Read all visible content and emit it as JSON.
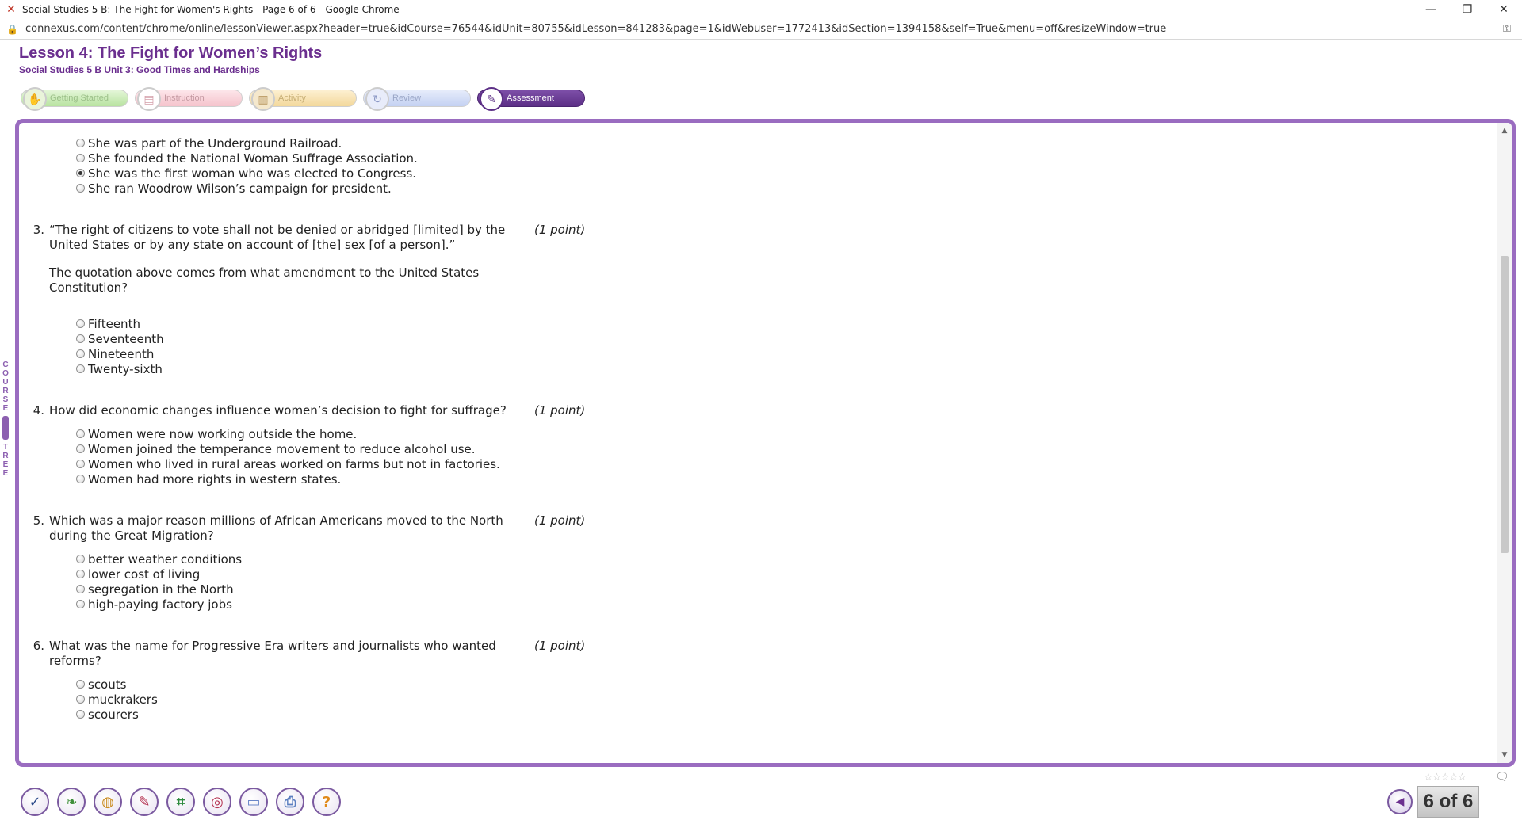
{
  "browser": {
    "window_title": "Social Studies 5 B: The Fight for Women's Rights - Page 6 of 6 - Google Chrome",
    "url": "connexus.com/content/chrome/online/lessonViewer.aspx?header=true&idCourse=76544&idUnit=80755&idLesson=841283&page=1&idWebuser=1772413&idSection=1394158&self=True&menu=off&resizeWindow=true",
    "minimize_icon": "minimize-icon",
    "maximize_icon": "restore-icon",
    "close_icon": "close-icon"
  },
  "lesson": {
    "title": "Lesson 4: The Fight for Women’s Rights",
    "subtitle": "Social Studies 5 B  Unit 3: Good Times and Hardships"
  },
  "tabs": [
    {
      "label": "Getting Started",
      "icon": "getting-started-icon"
    },
    {
      "label": "Instruction",
      "icon": "instruction-icon"
    },
    {
      "label": "Activity",
      "icon": "activity-icon"
    },
    {
      "label": "Review",
      "icon": "review-icon"
    },
    {
      "label": "Assessment",
      "icon": "assessment-icon",
      "active": true
    }
  ],
  "course_tree": {
    "letters": [
      "C",
      "O",
      "U",
      "R",
      "S",
      "E",
      "T",
      "R",
      "E",
      "E"
    ]
  },
  "questions": [
    {
      "number": "",
      "text": "",
      "points": "",
      "options": [
        {
          "label": "She was part of the Underground Railroad.",
          "selected": false
        },
        {
          "label": "She founded the National Woman Suffrage Association.",
          "selected": false
        },
        {
          "label": "She was the first woman who was elected to Congress.",
          "selected": true
        },
        {
          "label": "She ran Woodrow Wilson’s campaign for president.",
          "selected": false
        }
      ]
    },
    {
      "number": "3.",
      "text": "“The right of citizens to vote shall not be denied or abridged [limited] by the United States or by any state on account of [the] sex [of a person].”",
      "extra": "The quotation above comes from what amendment to the United States Constitution?",
      "points": "(1 point)",
      "options": [
        {
          "label": "Fifteenth",
          "selected": false
        },
        {
          "label": "Seventeenth",
          "selected": false
        },
        {
          "label": "Nineteenth",
          "selected": false
        },
        {
          "label": "Twenty-sixth",
          "selected": false
        }
      ]
    },
    {
      "number": "4.",
      "text": "How did economic changes influence women’s decision to fight for suffrage?",
      "points": "(1 point)",
      "options": [
        {
          "label": "Women were now working outside the home.",
          "selected": false
        },
        {
          "label": "Women joined the temperance movement to reduce alcohol use.",
          "selected": false
        },
        {
          "label": "Women who lived in rural areas worked on farms but not in factories.",
          "selected": false
        },
        {
          "label": "Women had more rights in western states.",
          "selected": false
        }
      ]
    },
    {
      "number": "5.",
      "text": "Which was a major reason millions of African Americans moved to the North during the Great Migration?",
      "points": "(1 point)",
      "options": [
        {
          "label": "better weather conditions",
          "selected": false
        },
        {
          "label": "lower cost of living",
          "selected": false
        },
        {
          "label": "segregation in the North",
          "selected": false
        },
        {
          "label": "high-paying factory jobs",
          "selected": false
        }
      ]
    },
    {
      "number": "6.",
      "text": "What was the name for Progressive Era writers and journalists who wanted reforms?",
      "points": "(1 point)",
      "options": [
        {
          "label": "scouts",
          "selected": false
        },
        {
          "label": "muckrakers",
          "selected": false
        },
        {
          "label": "scourers",
          "selected": false
        }
      ]
    }
  ],
  "toolbar": {
    "tools": [
      {
        "icon": "checkmark-icon",
        "glyph": "✓",
        "color": "#2b4a8a"
      },
      {
        "icon": "book-icon",
        "glyph": "❧",
        "color": "#3f8f3a"
      },
      {
        "icon": "globe-icon",
        "glyph": "◍",
        "color": "#c98a1d"
      },
      {
        "icon": "pushpin-icon",
        "glyph": "✎",
        "color": "#b3304f"
      },
      {
        "icon": "calculator-icon",
        "glyph": "⌗",
        "color": "#2e8a3e"
      },
      {
        "icon": "target-icon",
        "glyph": "◎",
        "color": "#b3304f"
      },
      {
        "icon": "screen-icon",
        "glyph": "▭",
        "color": "#6a86c8"
      },
      {
        "icon": "print-icon",
        "glyph": "⎙",
        "color": "#5b7fc0"
      },
      {
        "icon": "help-icon",
        "glyph": "?",
        "color": "#e08a1a"
      }
    ]
  },
  "rating": {
    "stars": 5,
    "filled": 0
  },
  "pager": {
    "indicator": "6 of 6",
    "back_icon": "previous-page-icon"
  }
}
